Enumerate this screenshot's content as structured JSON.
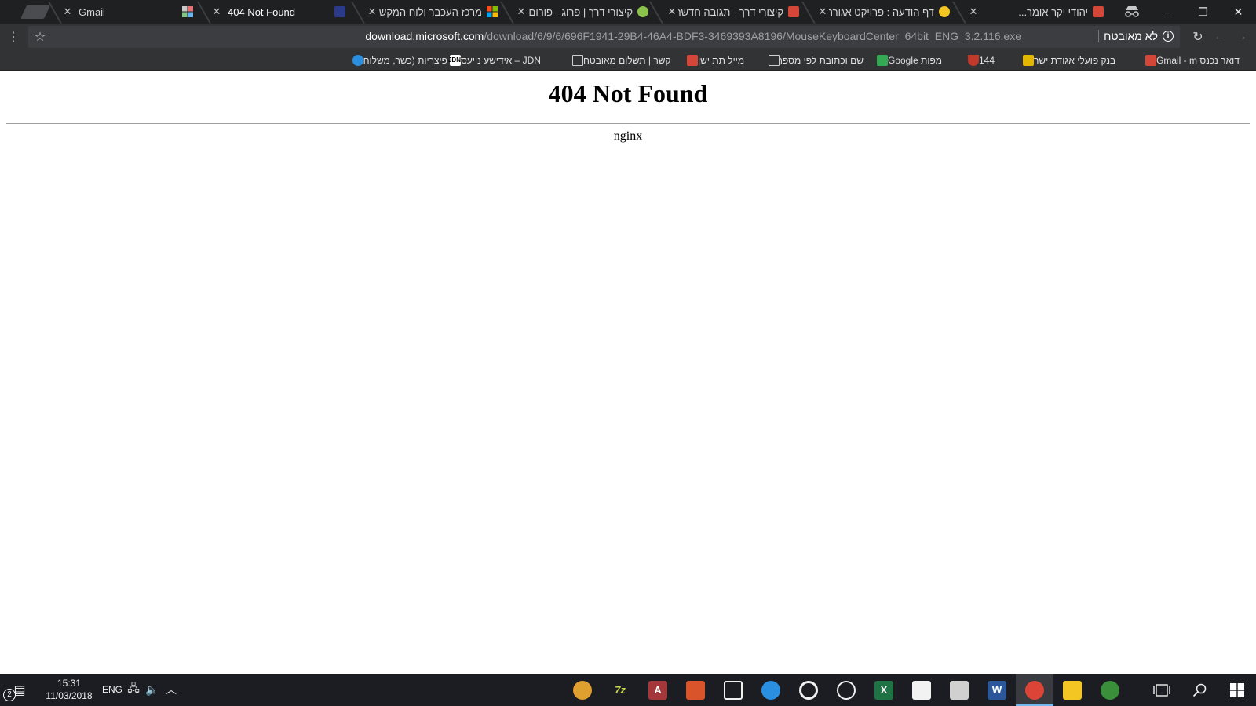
{
  "tabs": [
    {
      "title": "Gmail",
      "favicon": "gmail-icon",
      "active": false
    },
    {
      "title": "404 Not Found",
      "favicon": "generic-page-icon",
      "active": true
    },
    {
      "title": "מרכז העכבר ולוח המקש",
      "favicon": "microsoft-icon",
      "active": false
    },
    {
      "title": "קיצורי דרך | פרוג - פורום",
      "favicon": "prog-icon",
      "active": false
    },
    {
      "title": "קיצורי דרך - תגובה חדשה",
      "favicon": "gmail-icon",
      "active": false
    },
    {
      "title": "דף הודעה : פרויקט אגורה",
      "favicon": "info-icon",
      "active": false
    },
    {
      "title": "יהודי יקר אומר...",
      "favicon": "gmail-icon",
      "active": false
    }
  ],
  "omnibox": {
    "security_label": "לא מאובטח",
    "url_host": "download.microsoft.com",
    "url_path": "/download/6/9/6/696F1941-29B4-46A4-BDF3-3469393A8196/MouseKeyboardCenter_64bit_ENG_3.2.116.exe"
  },
  "bookmarks": [
    {
      "label": "דואר נכנס Gmail - m",
      "icon": "gmail-icon"
    },
    {
      "label": "בנק פועלי אגודת ישר",
      "icon": "bank-icon"
    },
    {
      "label": "144",
      "icon": "shield-icon"
    },
    {
      "label": "מפות Google",
      "icon": "maps-icon"
    },
    {
      "label": "שם וכתובת לפי מספר",
      "icon": "document-icon"
    },
    {
      "label": "מייל תת ישן",
      "icon": "gmail-icon"
    },
    {
      "label": "קשר | תשלום מאובטח",
      "icon": "document-icon"
    },
    {
      "label": "JDN – אידישע נייעס",
      "icon": "jdn-icon"
    },
    {
      "label": "פיצריות (כשר, משלוח",
      "icon": "q-icon"
    }
  ],
  "page": {
    "heading": "404 Not Found",
    "server": "nginx"
  },
  "taskbar": {
    "time": "15:31",
    "date": "11/03/2018",
    "language": "ENG",
    "notification_count": "2",
    "apps": [
      {
        "name": "picasa-icon",
        "letter": "",
        "color": "#e0a030"
      },
      {
        "name": "7zip-icon",
        "letter": "7z",
        "color": "#1c1d22"
      },
      {
        "name": "access-icon",
        "letter": "A",
        "color": "#a4373a"
      },
      {
        "name": "swirl-app-icon",
        "letter": "",
        "color": "#d9542b"
      },
      {
        "name": "video-editor-icon",
        "letter": "",
        "color": "#1c1d22"
      },
      {
        "name": "ccleaner-icon",
        "letter": "",
        "color": "#2a8fe0"
      },
      {
        "name": "target-app-icon",
        "letter": "",
        "color": "#1c1d22"
      },
      {
        "name": "webcam-icon",
        "letter": "",
        "color": "#1c1d22"
      },
      {
        "name": "excel-icon",
        "letter": "X",
        "color": "#1f7244"
      },
      {
        "name": "hebrew-app-icon",
        "letter": "",
        "color": "#f2f2f2"
      },
      {
        "name": "paint-icon",
        "letter": "",
        "color": "#d0d0d0"
      },
      {
        "name": "word-icon",
        "letter": "W",
        "color": "#2b579a"
      },
      {
        "name": "chrome-icon",
        "letter": "",
        "color": "#db4437"
      },
      {
        "name": "file-explorer-icon",
        "letter": "",
        "color": "#f3c623"
      },
      {
        "name": "globe-app-icon",
        "letter": "",
        "color": "#3a8f3a"
      }
    ]
  },
  "colors": {
    "tabstrip_bg": "#1f2021",
    "toolbar_bg": "#313335",
    "taskbar_bg": "#1c1d22",
    "taskbar_accent": "#76b9ed"
  }
}
